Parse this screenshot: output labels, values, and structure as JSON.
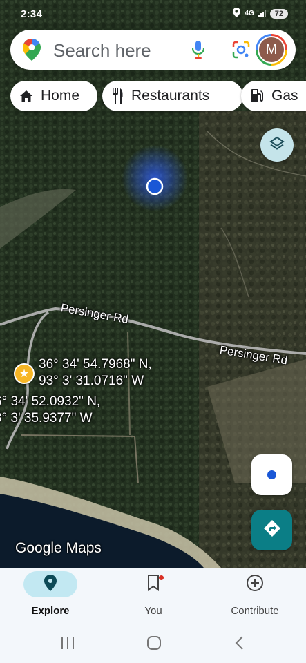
{
  "status_bar": {
    "time": "2:34",
    "network": "4G",
    "battery": "72"
  },
  "search": {
    "placeholder": "Search here",
    "avatar_initial": "M"
  },
  "chips": [
    {
      "label": "Home",
      "icon": "home-icon"
    },
    {
      "label": "Restaurants",
      "icon": "restaurant-icon"
    },
    {
      "label": "Gas",
      "icon": "gas-station-icon"
    }
  ],
  "map": {
    "roads": [
      {
        "name": "Persinger Rd"
      },
      {
        "name": "Persinger Rd"
      }
    ],
    "pins": [
      {
        "lat": "36° 34' 54.7968\" N,",
        "lng": "93° 3' 31.0716\" W"
      },
      {
        "lat": "6° 34' 52.0932\" N,",
        "lng": "3° 3' 35.9377\" W"
      }
    ],
    "watermark": "Google Maps",
    "colors": {
      "forest": "#23301f",
      "water": "#0c1b2b",
      "road": "#b9b9b9",
      "location_dot": "#1a57d6",
      "accent": "#0b7e86",
      "pin": "#f7b626"
    }
  },
  "controls": {
    "layers_icon": "layers-icon",
    "my_location_icon": "my-location-icon",
    "directions_icon": "directions-icon"
  },
  "bottom_nav": {
    "items": [
      {
        "label": "Explore",
        "icon": "explore-pin-icon",
        "active": true
      },
      {
        "label": "You",
        "icon": "bookmark-icon",
        "active": false
      },
      {
        "label": "Contribute",
        "icon": "add-circle-icon",
        "active": false
      }
    ]
  },
  "system_nav": {
    "icons": [
      "recents-icon",
      "home-icon",
      "back-icon"
    ]
  }
}
